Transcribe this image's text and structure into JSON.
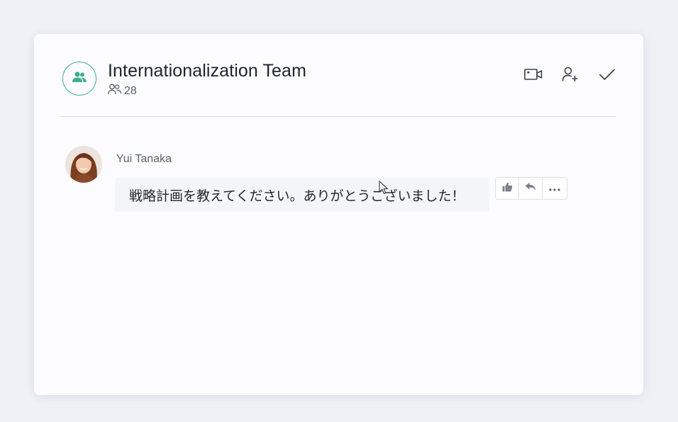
{
  "chat": {
    "title": "Internationalization Team",
    "member_count": "28",
    "icons": {
      "group": "group-icon",
      "members": "members-icon",
      "video": "video-call-icon",
      "add_member": "add-member-icon",
      "done": "checkmark-icon"
    },
    "accent_color": "#3fae8f"
  },
  "message": {
    "sender": "Yui Tanaka",
    "text": "戦略計画を教えてください。ありがとうございました！",
    "actions": [
      "thumbs-up-icon",
      "reply-icon",
      "more-icon"
    ]
  }
}
